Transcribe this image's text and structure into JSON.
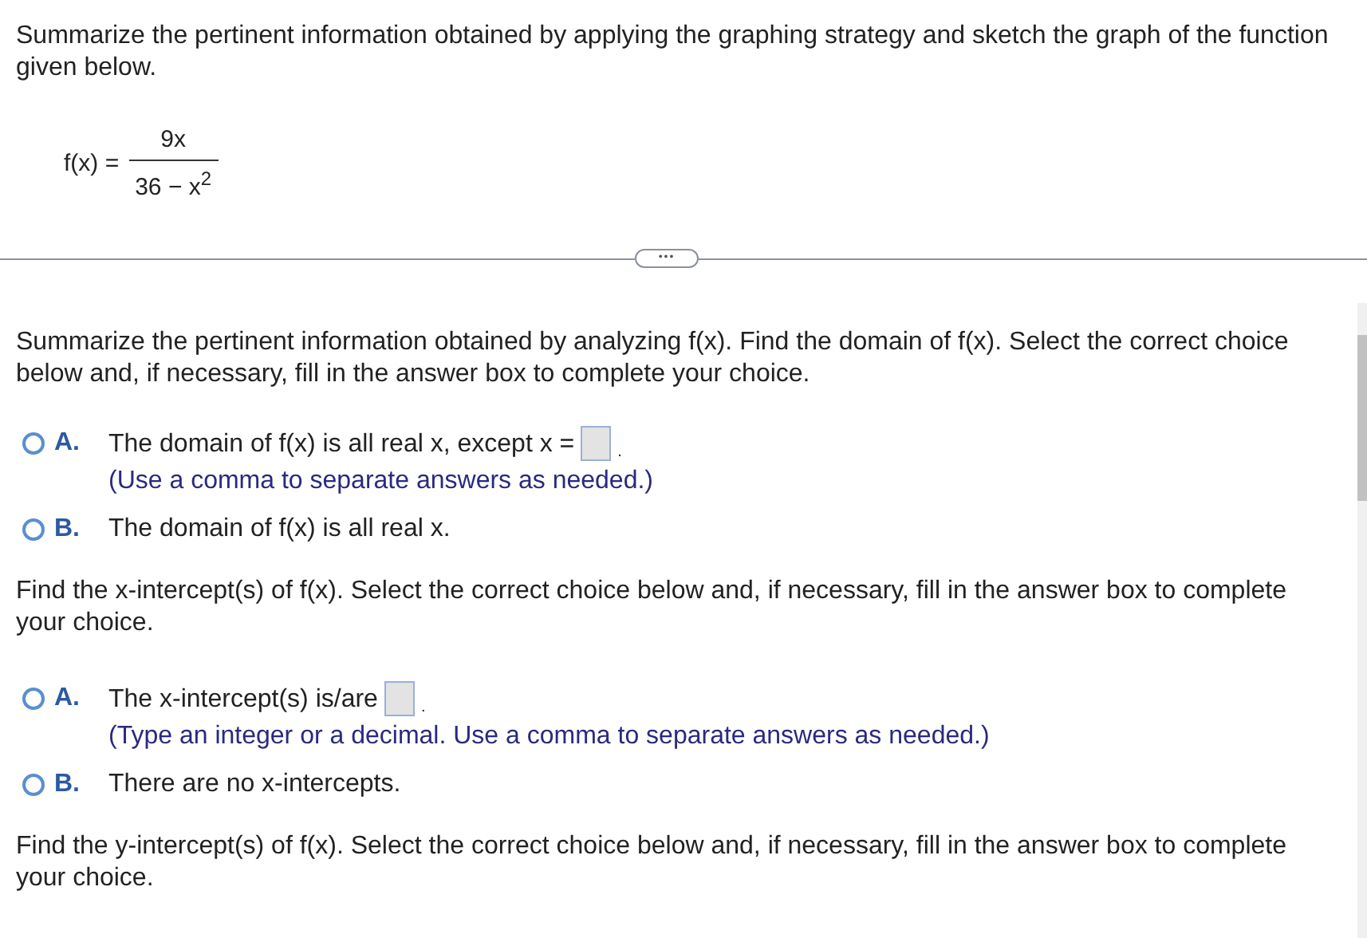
{
  "question": "Summarize the pertinent information obtained by applying the graphing strategy and sketch the graph of the function given below.",
  "formula": {
    "lhs": "f(x) =",
    "numerator": "9x",
    "denominator": "36 − x$^{2}$"
  },
  "divider": {
    "label": "•••"
  },
  "parts": [
    {
      "prompt": "Summarize the pertinent information obtained by analyzing f(x). Find the domain of f(x). Select the correct choice below and, if necessary, fill in the answer box to complete your choice.",
      "choices": [
        {
          "letter": "A.",
          "kind": "answer",
          "text": "The domain of f(x) is all real x, except x =",
          "after": ".",
          "hint": "(Use a comma to separate answers as needed.)",
          "selected": false
        },
        {
          "letter": "B.",
          "kind": "plain",
          "text": "The domain of f(x) is all real x.",
          "selected": false
        }
      ]
    },
    {
      "prompt": "Find the x-intercept(s) of f(x). Select the correct choice below and, if necessary, fill in the answer box to complete your choice.",
      "choices": [
        {
          "letter": "A.",
          "kind": "answer",
          "text": "The x-intercept(s) is/are",
          "after": ".",
          "hint": "(Type an integer or a decimal. Use a comma to separate answers as needed.)",
          "selected": false
        },
        {
          "letter": "B.",
          "kind": "plain",
          "text": "There are no x-intercepts.",
          "selected": false
        }
      ]
    },
    {
      "prompt": "Find the y-intercept(s) of f(x). Select the correct choice below and, if necessary, fill in the answer box to complete your choice."
    }
  ]
}
